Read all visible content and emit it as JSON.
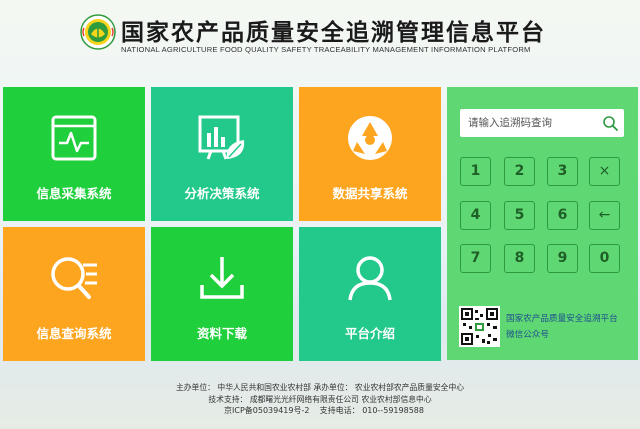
{
  "header": {
    "title": "国家农产品质量安全追溯管理信息平台",
    "subtitle": "NATIONAL AGRICULTURE  FOOD QUALITY SAFETY TRACEABILITY MANAGEMENT INFORMATION PLATFORM"
  },
  "tiles": [
    {
      "label": "信息采集系统",
      "icon": "monitor-pulse-icon",
      "color": "#1fcf3c"
    },
    {
      "label": "分析决策系统",
      "icon": "chart-leaf-icon",
      "color": "#22c98a"
    },
    {
      "label": "数据共享系统",
      "icon": "share-cycle-icon",
      "color": "#fda51f"
    },
    {
      "label": "信息查询系统",
      "icon": "search-list-icon",
      "color": "#fda51f"
    },
    {
      "label": "资料下载",
      "icon": "download-icon",
      "color": "#1fcf3c"
    },
    {
      "label": "平台介绍",
      "icon": "user-icon",
      "color": "#22c98a"
    }
  ],
  "search": {
    "placeholder": "请输入追溯码查询"
  },
  "keypad": {
    "keys": [
      "1",
      "2",
      "3",
      "×",
      "4",
      "5",
      "6",
      "←",
      "7",
      "8",
      "9",
      "0"
    ]
  },
  "wechat": {
    "line1": "国家农产品质量安全追溯平台",
    "line2": "微信公众号"
  },
  "footer": {
    "line1": "主办单位：  中华人民共和国农业农村部    承办单位：  农业农村部农产品质量安全中心",
    "line2": "技术支持：  成都曙光光纤网络有限责任公司    农业农村部信息中心",
    "icp": "京ICP备05039419号-2",
    "phone": "支持电话：  010--59198588"
  },
  "colors": {
    "green": "#1fcf3c",
    "teal": "#22c98a",
    "orange": "#fda51f",
    "panel": "#5fd873"
  }
}
